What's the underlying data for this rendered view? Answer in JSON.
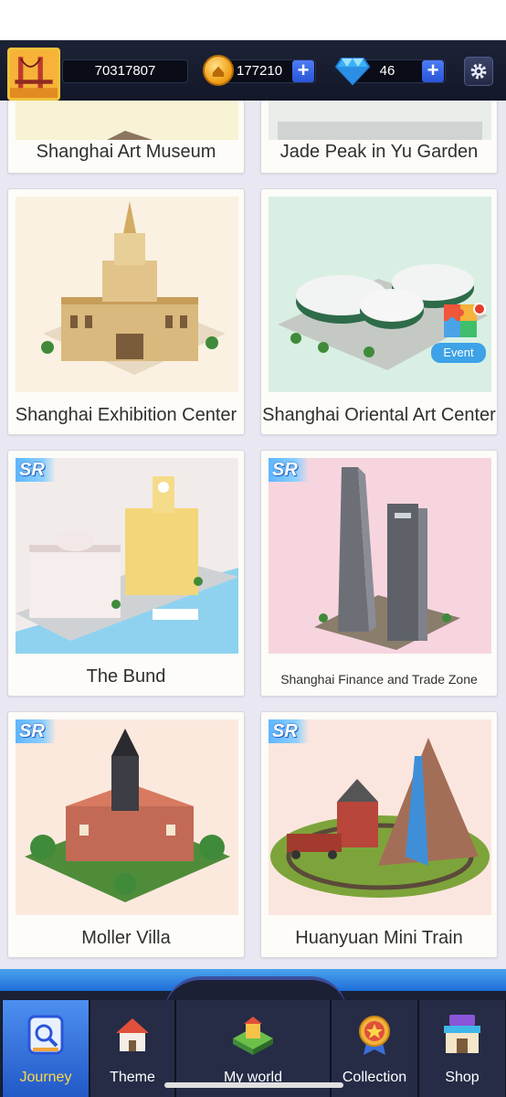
{
  "header": {
    "score": "70317807",
    "coins": "177210",
    "gems": "46",
    "plus_symbol": "+"
  },
  "cards": [
    {
      "name": "Shanghai Art Museum",
      "badge": "",
      "event": false
    },
    {
      "name": "Jade Peak in Yu Garden",
      "badge": "",
      "event": false
    },
    {
      "name": "Shanghai Exhibition Center",
      "badge": "",
      "event": false
    },
    {
      "name": "Shanghai Oriental Art Center",
      "badge": "",
      "event": true,
      "event_label": "Event"
    },
    {
      "name": "The Bund",
      "badge": "SR",
      "event": false
    },
    {
      "name": "Shanghai Finance and Trade Zone",
      "badge": "SR",
      "event": false
    },
    {
      "name": "Moller Villa",
      "badge": "SR",
      "event": false
    },
    {
      "name": "Huanyuan Mini Train",
      "badge": "SR",
      "event": false
    }
  ],
  "nav": {
    "tabs": [
      {
        "label": "Journey",
        "icon": "journey-icon",
        "active": true
      },
      {
        "label": "Theme",
        "icon": "house-icon",
        "active": false
      },
      {
        "label": "My world",
        "icon": "world-icon",
        "active": false
      },
      {
        "label": "Collection",
        "icon": "medal-icon",
        "active": false
      },
      {
        "label": "Shop",
        "icon": "shop-icon",
        "active": false
      }
    ]
  },
  "colors": {
    "accent_blue": "#2a55d8",
    "active_tab": "#4d8ff0",
    "active_label": "#ffd84a",
    "sr_badge": "#5fb6ff"
  }
}
